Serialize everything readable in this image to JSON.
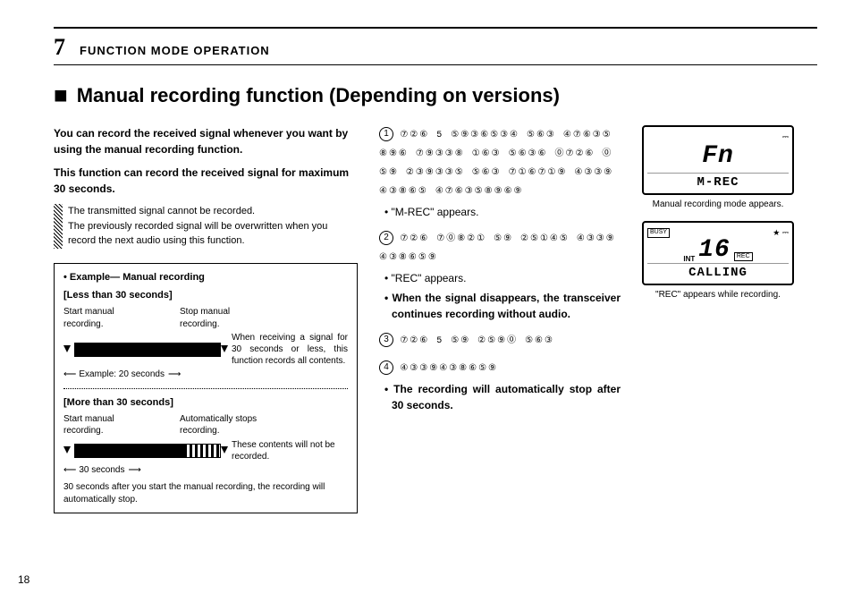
{
  "header": {
    "chapter_num": "7",
    "chapter_title": "FUNCTION MODE OPERATION"
  },
  "title": {
    "mark": "■",
    "text": "Manual recording function (Depending on versions)"
  },
  "intro": {
    "p1": "You can record the received signal whenever you want by using the manual recording function.",
    "p2": "This function can record the received signal for maximum 30 seconds."
  },
  "notes": {
    "n1": "The transmitted signal cannot be recorded.",
    "n2": "The previously recorded signal will be overwritten when you record the next audio using this function."
  },
  "example": {
    "title": "• Example— Manual recording",
    "sub1": "[Less than 30 seconds]",
    "d1": {
      "start_label": "Start manual recording.",
      "stop_label": "Stop manual recording.",
      "under_label": "Example: 20 seconds",
      "side_note": "When receiving a signal for 30 seconds or less, this function records all contents."
    },
    "sub2": "[More than 30 seconds]",
    "d2": {
      "start_label": "Start manual recording.",
      "stop_label": "Automatically stops recording.",
      "under_label": "30 seconds",
      "side_note": "These contents will not be recorded."
    },
    "footer": "30 seconds after you start the manual recording, the recording will automatically stop."
  },
  "steps": {
    "s1": {
      "glyphs": "⑦②⑥ 5 ⑤⑨③⑥⑤③④ ⑤⑥③ ④⑦⑥③⑤⑧⑨⑥ ⑦⑨③③⑧ ①⑥③ ⑤⑥③⑥ ⓪⑦②⑥ ⓪ ⑤⑨ ②③⑨③③⑤ ⑤⑥③ ⑦①⑥⑦①⑨ ④③③⑨④③⑧⑥⑤ ④⑦⑥③⑤⑧⑨⑥⑨",
      "bullet1": "• \"M-REC\" appears."
    },
    "s2": {
      "glyphs": "⑦②⑥ ⑦⓪⑧②① ⑤⑨ ②⑤①④⑤ ④③③⑨④③⑧⑥⑤⑨",
      "bullet1": "• \"REC\" appears.",
      "bullet2": "• When the signal disappears, the transceiver continues recording without audio."
    },
    "s3": {
      "glyphs": "⑦②⑥ 5 ⑤⑨ ②⑤⑨⓪ ⑤⑥③"
    },
    "s4": {
      "glyphs": "④③③⑨④③⑧⑥⑤⑨",
      "bullet1": "• The recording will automatically stop after 30 seconds."
    }
  },
  "lcd1": {
    "icon": "⎓",
    "big": "Fn",
    "small": "M-REC",
    "caption": "Manual recording mode appears."
  },
  "lcd2": {
    "busy": "BUSY",
    "star": "★",
    "icon": "⎓",
    "int": "INT",
    "rec": "REC",
    "big": "16",
    "small": "CALLING",
    "caption": "\"REC\" appears while recording."
  },
  "page_num": "18"
}
